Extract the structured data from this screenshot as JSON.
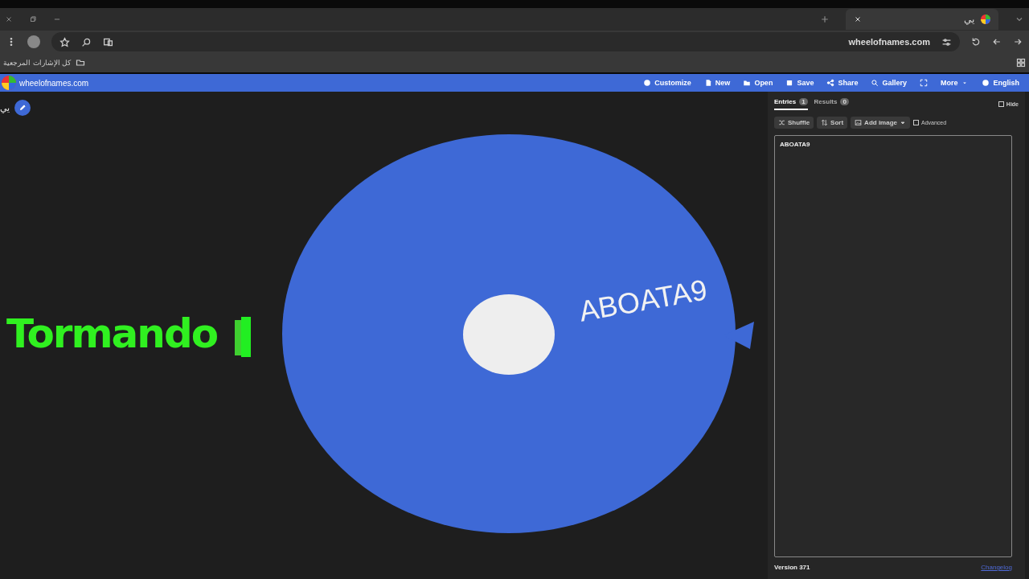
{
  "browser": {
    "tab": {
      "title": "يي"
    },
    "address": "wheelofnames.com",
    "bookmarks": [
      {
        "label": "كل الإشارات المرجعية"
      }
    ]
  },
  "app": {
    "site_title": "wheelofnames.com",
    "menu": [
      "Customize",
      "New",
      "Open",
      "Save",
      "Share",
      "Gallery",
      "More",
      "English"
    ]
  },
  "wheel": {
    "title": "يي",
    "segments": [
      {
        "label": "ABOATA9",
        "color": "#3e69d6"
      }
    ]
  },
  "overlay": {
    "caption": "Tormando"
  },
  "panel": {
    "tabs": [
      {
        "label": "Entries",
        "count": "1",
        "selected": true
      },
      {
        "label": "Results",
        "count": "0",
        "selected": false
      }
    ],
    "hide": {
      "label": "Hide",
      "checked": false
    },
    "tools": [
      "Shuffle",
      "Sort",
      "Add image"
    ],
    "advanced": {
      "label": "Advanced",
      "checked": false
    },
    "entries": "ABOATA9",
    "version": "Version 371",
    "changelog": "Changelog"
  }
}
